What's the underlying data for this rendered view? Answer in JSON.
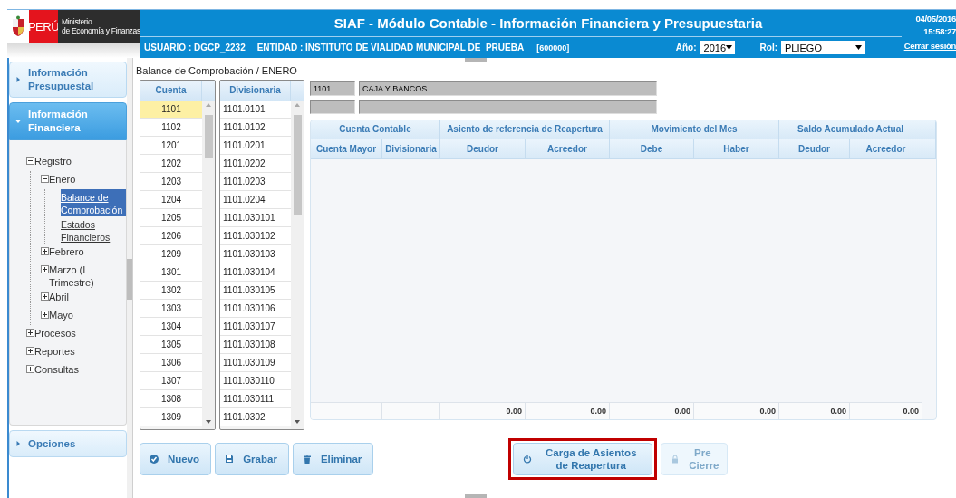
{
  "header": {
    "logo": {
      "country": "PERÚ",
      "ministry_line1": "Ministerio",
      "ministry_line2": "de Economía y Finanzas"
    },
    "title": "SIAF - Módulo Contable - Información Financiera y Presupuestaria",
    "date": "04/05/2016",
    "time": "15:58:27",
    "logout": "Cerrar sesión",
    "user": "USUARIO : DGCP_2232",
    "entity": "ENTIDAD : INSTITUTO DE VIALIDAD MUNICIPAL DE  PRUEBA",
    "code": "[600000]",
    "year_label": "Año:",
    "year": "2016",
    "role_label": "Rol:",
    "role": "PLIEGO"
  },
  "sidebar": {
    "panels": [
      {
        "label": "Información Presupuestal",
        "expanded": false
      },
      {
        "label": "Información Financiera",
        "expanded": true,
        "tree": [
          {
            "label": "Registro",
            "kind": "folder",
            "expanded": true,
            "selected": false,
            "children": [
              {
                "label": "Enero",
                "kind": "folder",
                "expanded": true,
                "selected": false,
                "children": [
                  {
                    "label": "Balance de Comprobación",
                    "kind": "link",
                    "selected": true
                  },
                  {
                    "label": "Estados Financieros",
                    "kind": "link",
                    "selected": false
                  }
                ]
              },
              {
                "label": "Febrero",
                "kind": "folder",
                "expanded": false,
                "selected": false
              },
              {
                "label": "Marzo (I Trimestre)",
                "kind": "folder",
                "expanded": false,
                "selected": false
              },
              {
                "label": "Abril",
                "kind": "folder",
                "expanded": false,
                "selected": false
              },
              {
                "label": "Mayo",
                "kind": "folder",
                "expanded": false,
                "selected": false
              }
            ]
          },
          {
            "label": "Procesos",
            "kind": "folder",
            "expanded": false,
            "selected": false
          },
          {
            "label": "Reportes",
            "kind": "folder",
            "expanded": false,
            "selected": false
          },
          {
            "label": "Consultas",
            "kind": "folder",
            "expanded": false,
            "selected": false
          }
        ]
      },
      {
        "label": "Opciones",
        "expanded": false
      }
    ]
  },
  "breadcrumb": "Balance de Comprobación / ENERO",
  "cuenta_list": {
    "header": "Cuenta",
    "rows": [
      {
        "text": "1101",
        "selected": true
      },
      {
        "text": "1102",
        "selected": false
      },
      {
        "text": "1201",
        "selected": false
      },
      {
        "text": "1202",
        "selected": false
      },
      {
        "text": "1203",
        "selected": false
      },
      {
        "text": "1204",
        "selected": false
      },
      {
        "text": "1205",
        "selected": false
      },
      {
        "text": "1206",
        "selected": false
      },
      {
        "text": "1209",
        "selected": false
      },
      {
        "text": "1301",
        "selected": false
      },
      {
        "text": "1302",
        "selected": false
      },
      {
        "text": "1303",
        "selected": false
      },
      {
        "text": "1304",
        "selected": false
      },
      {
        "text": "1305",
        "selected": false
      },
      {
        "text": "1306",
        "selected": false
      },
      {
        "text": "1307",
        "selected": false
      },
      {
        "text": "1308",
        "selected": false
      },
      {
        "text": "1309",
        "selected": false
      }
    ]
  },
  "divisionaria_list": {
    "header": "Divisionaria",
    "rows": [
      {
        "text": "1101.0101",
        "selected": false
      },
      {
        "text": "1101.0102",
        "selected": false
      },
      {
        "text": "1101.0201",
        "selected": false
      },
      {
        "text": "1101.0202",
        "selected": false
      },
      {
        "text": "1101.0203",
        "selected": false
      },
      {
        "text": "1101.0204",
        "selected": false
      },
      {
        "text": "1101.030101",
        "selected": false
      },
      {
        "text": "1101.030102",
        "selected": false
      },
      {
        "text": "1101.030103",
        "selected": false
      },
      {
        "text": "1101.030104",
        "selected": false
      },
      {
        "text": "1101.030105",
        "selected": false
      },
      {
        "text": "1101.030106",
        "selected": false
      },
      {
        "text": "1101.030107",
        "selected": false
      },
      {
        "text": "1101.030108",
        "selected": false
      },
      {
        "text": "1101.030109",
        "selected": false
      },
      {
        "text": "1101.030110",
        "selected": false
      },
      {
        "text": "1101.030111",
        "selected": false
      },
      {
        "text": "1101.0302",
        "selected": false
      }
    ]
  },
  "account": {
    "code": "1101",
    "name": "CAJA Y BANCOS"
  },
  "table": {
    "groups": [
      "Cuenta Contable",
      "Asiento de referencia de Reapertura",
      "Movimiento del Mes",
      "Saldo Acumulado Actual"
    ],
    "columns": [
      "Cuenta Mayor",
      "Divisionaria",
      "Deudor",
      "Acreedor",
      "Debe",
      "Haber",
      "Deudor",
      "Acreedor"
    ],
    "totals": [
      "0.00",
      "0.00",
      "0.00",
      "0.00",
      "0.00",
      "0.00"
    ]
  },
  "buttons": [
    {
      "label": "Nuevo",
      "disabled": false,
      "highlighted": false
    },
    {
      "label": "Grabar",
      "disabled": false,
      "highlighted": false
    },
    {
      "label": "Eliminar",
      "disabled": false,
      "highlighted": false
    },
    {
      "label": "Carga de Asientos de Reapertura",
      "disabled": false,
      "highlighted": true
    },
    {
      "label": "Pre Cierre",
      "disabled": true,
      "highlighted": false
    }
  ]
}
